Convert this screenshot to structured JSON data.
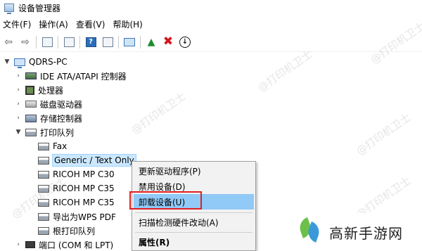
{
  "window": {
    "title": "设备管理器"
  },
  "menubar": {
    "items": [
      "文件(F)",
      "操作(A)",
      "查看(V)",
      "帮助(H)"
    ]
  },
  "toolbar": {
    "buttons": [
      "back-icon",
      "forward-icon",
      "show-hide-tree-icon",
      "properties-icon",
      "help-icon",
      "view-icon",
      "monitor-icon",
      "update-driver-icon",
      "uninstall-icon",
      "disable-icon"
    ],
    "help_glyph": "?"
  },
  "tree": {
    "root": "QDRS-PC",
    "categories": [
      {
        "label": "IDE ATA/ATAPI 控制器",
        "icon": "ide-controller-icon",
        "expanded": false
      },
      {
        "label": "处理器",
        "icon": "cpu-icon",
        "expanded": false
      },
      {
        "label": "磁盘驱动器",
        "icon": "disk-icon",
        "expanded": false
      },
      {
        "label": "存储控制器",
        "icon": "storage-controller-icon",
        "expanded": false
      },
      {
        "label": "打印队列",
        "icon": "printer-icon",
        "expanded": true
      }
    ],
    "print_queue_items": [
      "Fax",
      "Generic / Text Only",
      "RICOH MP C30",
      "RICOH MP C35",
      "RICOH MP C35",
      "导出为WPS PDF",
      "根打印队列"
    ],
    "last_category": "端口 (COM 和 LPT)"
  },
  "context_menu": {
    "items": [
      "更新驱动程序(P)",
      "禁用设备(D)",
      "卸载设备(U)",
      "扫描检测硬件改动(A)",
      "属性(R)"
    ],
    "highlighted_index": 2
  },
  "watermark": {
    "text": "@打印机卫士"
  },
  "brand": {
    "name": "高新手游网"
  },
  "colors": {
    "highlight": "#91c9f7",
    "selection": "#cce8ff",
    "annotation_box": "#e02020"
  }
}
